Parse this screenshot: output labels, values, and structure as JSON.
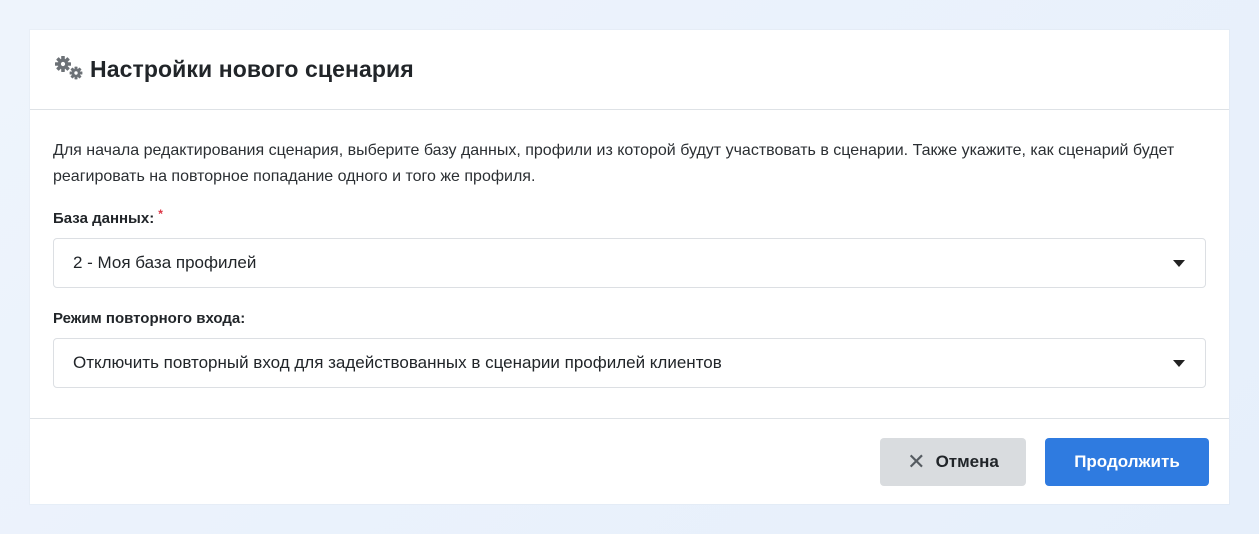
{
  "modal": {
    "title": "Настройки нового сценария",
    "icon": "gears-icon"
  },
  "body": {
    "description": "Для начала редактирования сценария, выберите базу данных, профили из которой будут участвовать в сценарии. Также укажите, как сценарий будет реагировать на повторное попадание одного и того же профиля.",
    "database": {
      "label": "База данных:",
      "required_mark": "*",
      "selected": "2 - Моя база профилей"
    },
    "reentry": {
      "label": "Режим повторного входа:",
      "selected": "Отключить повторный вход для задействованных в сценарии профилей клиентов"
    }
  },
  "footer": {
    "cancel_icon": "✕",
    "cancel_label": "Отмена",
    "continue_label": "Продолжить"
  },
  "colors": {
    "primary": "#2f7be0",
    "cancel_bg": "#d9dcdf",
    "required": "#dc3545"
  }
}
